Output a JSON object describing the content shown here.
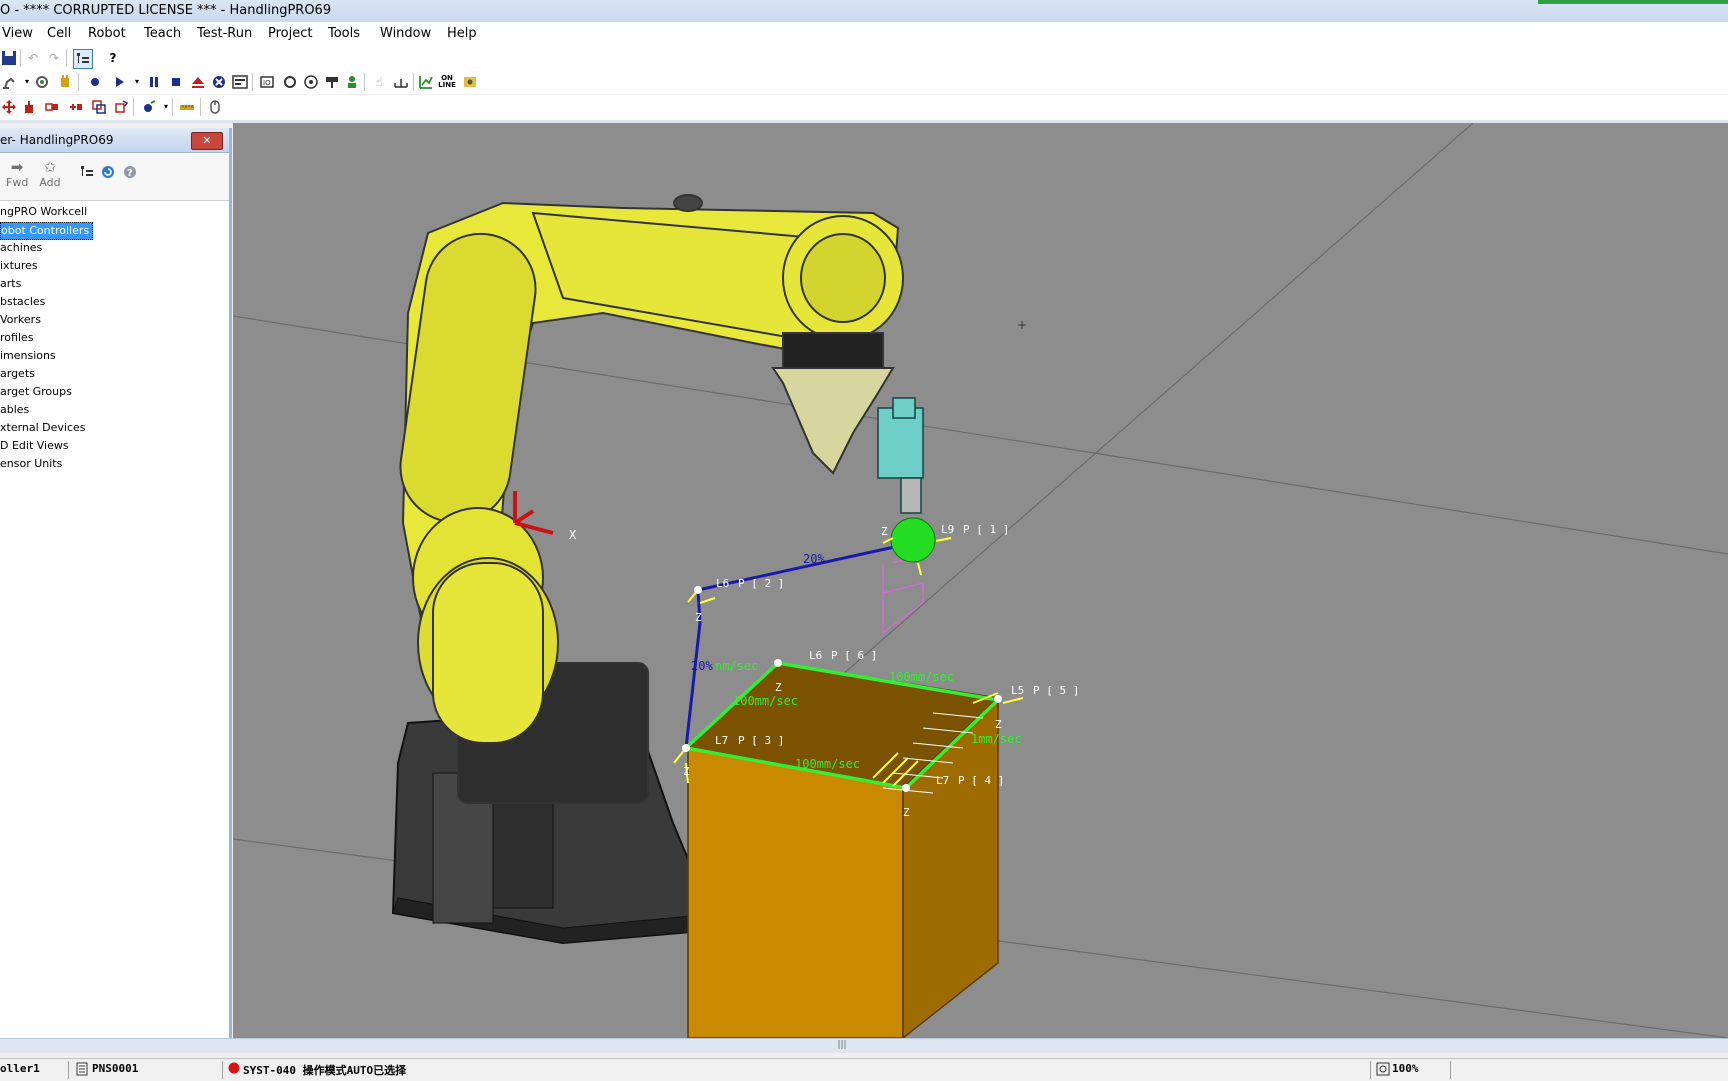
{
  "window": {
    "title": "O - **** CORRUPTED LICENSE *** - HandlingPRO69"
  },
  "menu": [
    "View",
    "Cell",
    "Robot",
    "Teach",
    "Test-Run",
    "Project",
    "Tools",
    "Window",
    "Help"
  ],
  "toolbar": {
    "online_label": "ON LINE"
  },
  "panel": {
    "title": "er- HandlingPRO69",
    "close_label": "✕",
    "fwd_label": "Fwd",
    "add_label": "Add",
    "tree": [
      "ngPRO Workcell",
      "obot Controllers",
      "achines",
      "ixtures",
      "arts",
      "bstacles",
      "Vorkers",
      "rofiles",
      "imensions",
      "argets",
      "arget Groups",
      "ables",
      "xternal Devices",
      "D Edit Views",
      "ensor Units"
    ],
    "selected_index": 1
  },
  "scene": {
    "positions": [
      {
        "label": "P [ 1 ]",
        "mark": "L9",
        "frame": "Z"
      },
      {
        "label": "P [ 2 ]",
        "mark": "L6",
        "frame": "Z"
      },
      {
        "label": "P [ 3 ]",
        "mark": "L7",
        "frame": "Z"
      },
      {
        "label": "P [ 4 ]",
        "mark": "L7",
        "frame": "Z"
      },
      {
        "label": "P [ 5 ]",
        "mark": "L5",
        "frame": "Z"
      },
      {
        "label": "P [ 6 ]",
        "mark": "L6",
        "frame": "Z"
      }
    ],
    "speeds": {
      "j1": "20%",
      "j2": "20%",
      "l_start": "nm/sec",
      "l_a": "100mm/sec",
      "l_b": "100mm/sec",
      "l_c": "100mm/sec",
      "l_d": "1mm/sec"
    },
    "colors": {
      "background": "#8d8d8d",
      "robot": "#e6e63a",
      "robot_base": "#333333",
      "box": "#c98a00",
      "joint_path": "#1a1aa8",
      "linear_path": "#33ee33",
      "sphere": "#22dd22"
    }
  },
  "status": {
    "controller": "oller1",
    "program": "PNS0001",
    "message": "SYST-040 操作模式AUTO已选择",
    "zoom": "100%"
  }
}
